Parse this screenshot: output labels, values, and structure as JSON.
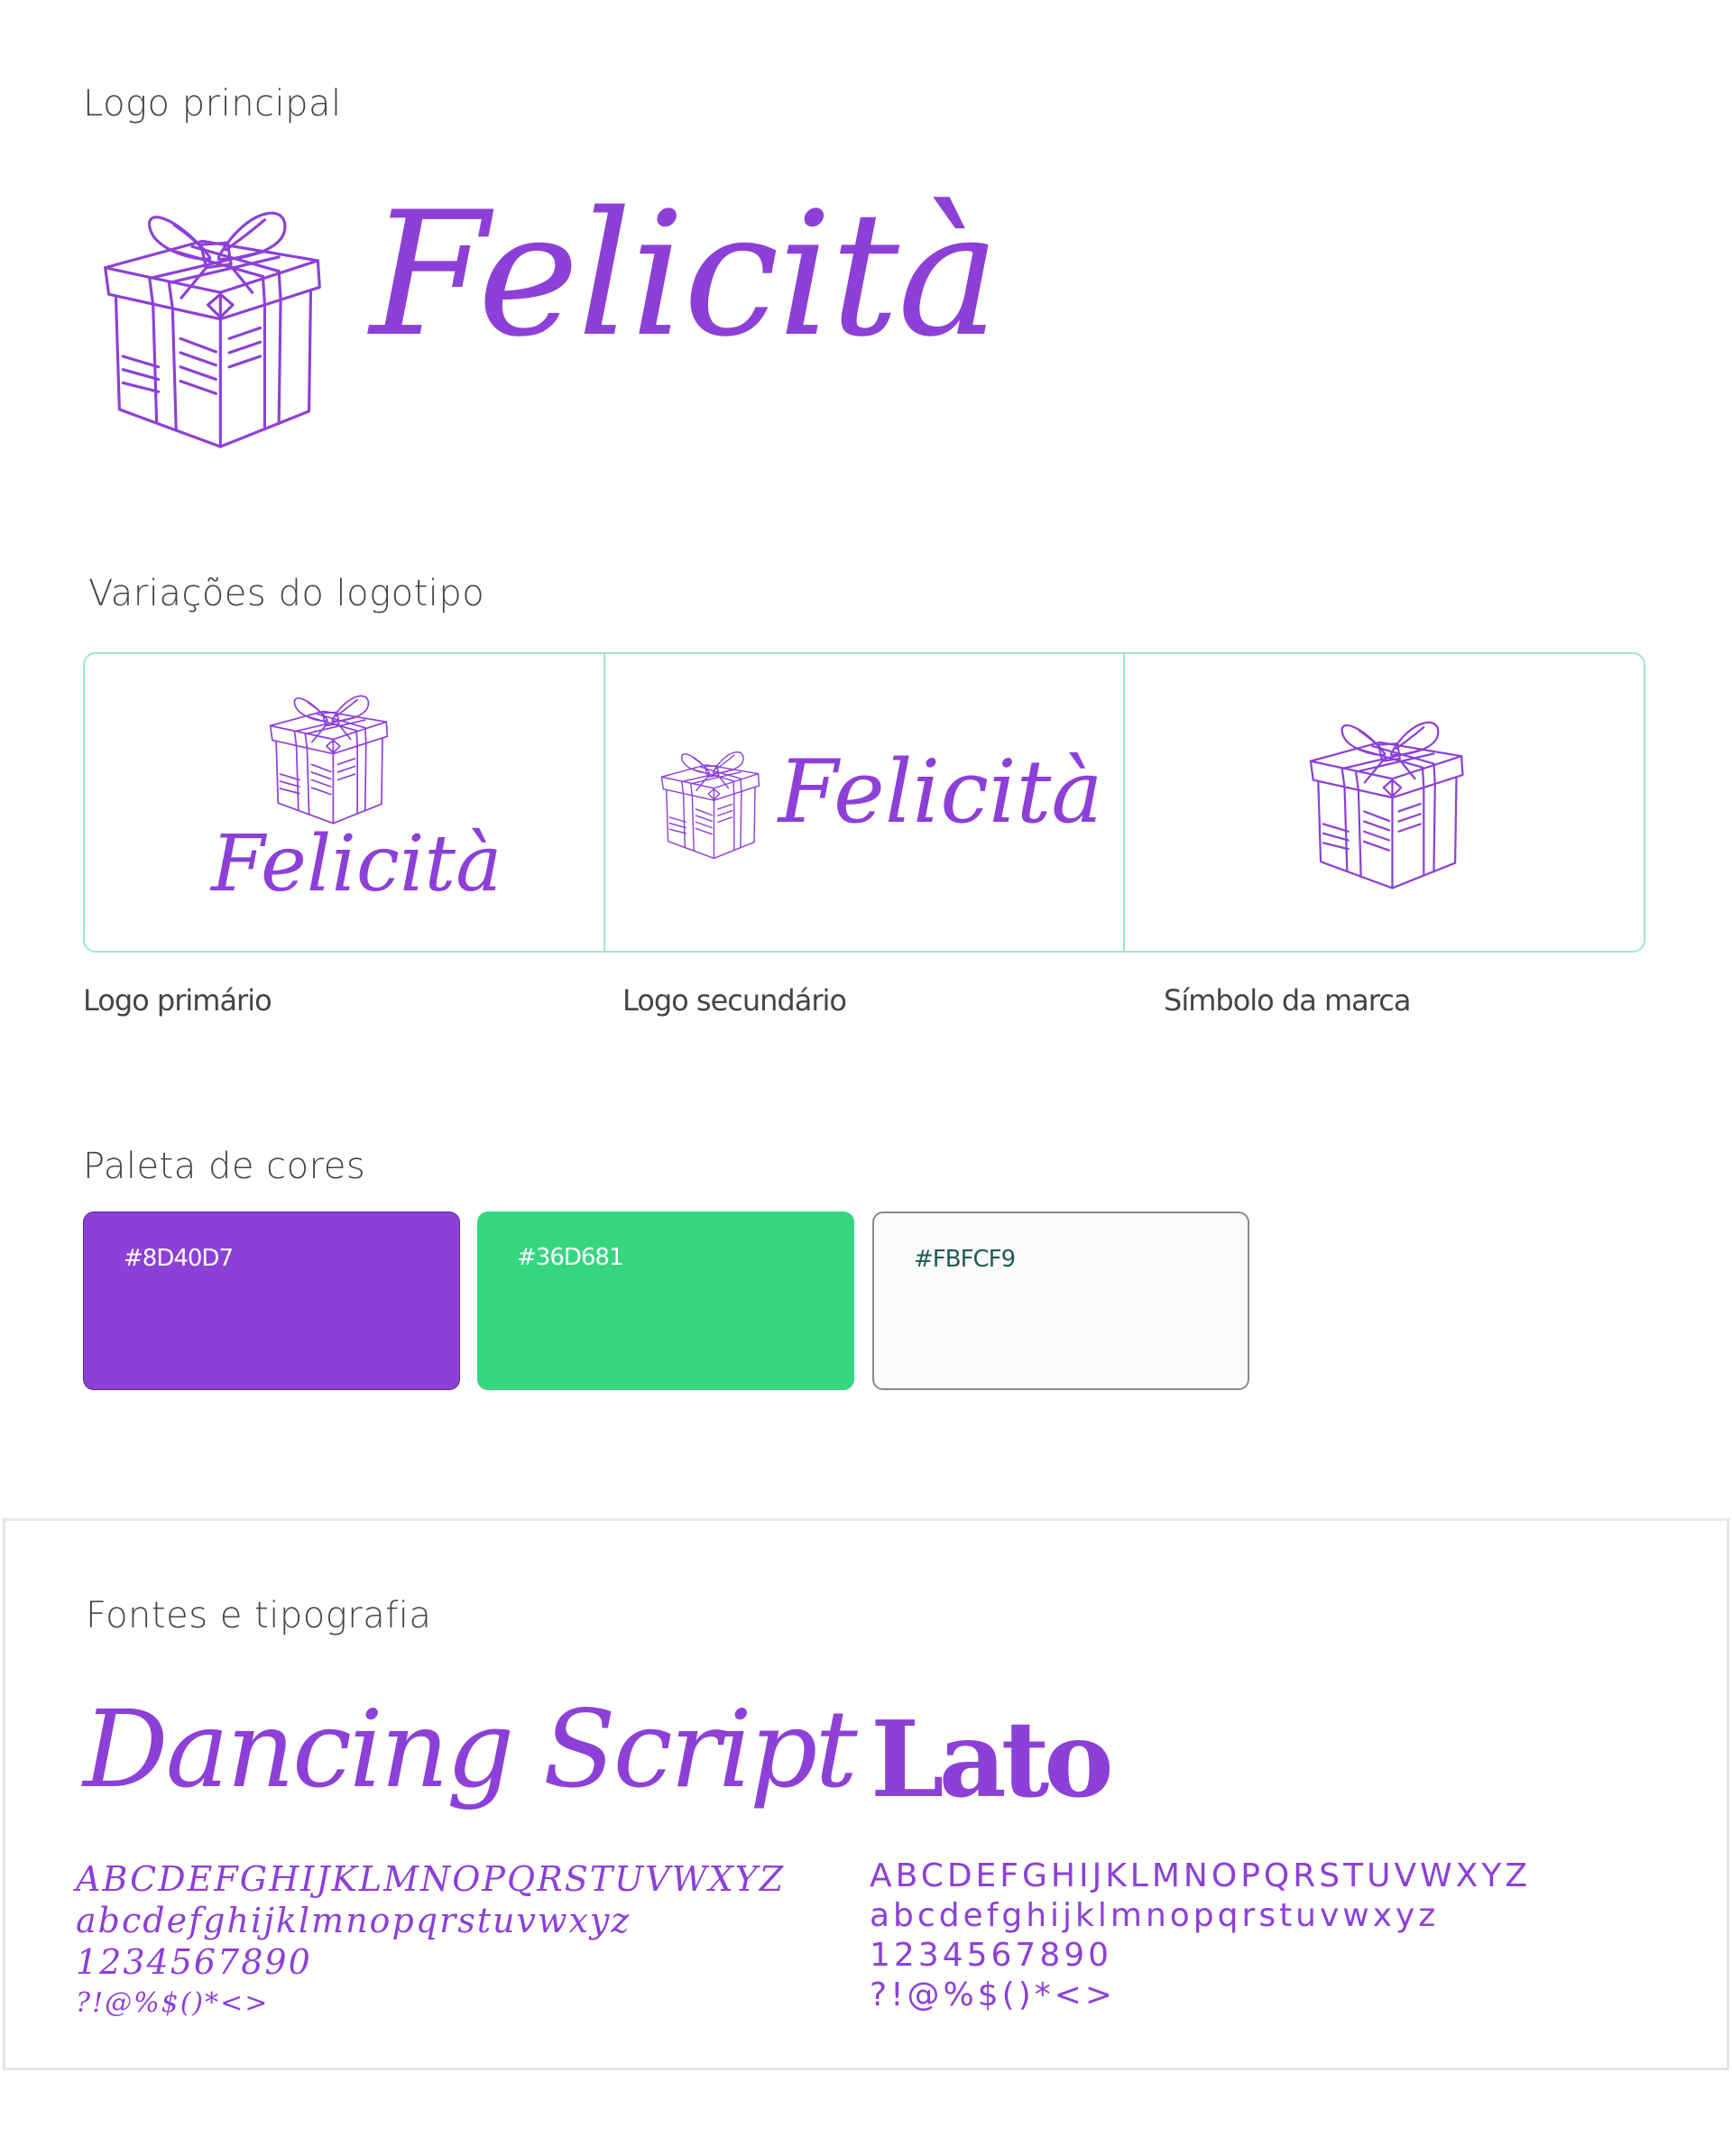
{
  "brand": {
    "name": "Felicità"
  },
  "colors": {
    "primary": "#8D40D7",
    "secondary": "#36D681",
    "neutral": "#FBFCF9",
    "border_accent": "#9fe9c6"
  },
  "main_logo": {
    "title": "Logo principal",
    "wordmark": "Felicità",
    "symbol_icon": "gift-box-icon"
  },
  "variations": {
    "title": "Variações do logotipo",
    "items": [
      {
        "caption": "Logo primário",
        "wordmark": "Felicità",
        "layout": "stacked"
      },
      {
        "caption": "Logo secundário",
        "wordmark": "Felicità",
        "layout": "horizontal"
      },
      {
        "caption": "Símbolo da marca",
        "layout": "symbol-only"
      }
    ]
  },
  "palette": {
    "title": "Paleta de cores",
    "swatches": [
      {
        "hex": "#8D40D7",
        "label": "#8D40D7",
        "text_color": "#ffffff"
      },
      {
        "hex": "#36D681",
        "label": "#36D681",
        "text_color": "#ffffff"
      },
      {
        "hex": "#FBFCF9",
        "label": "#FBFCF9",
        "text_color": "#1f5a5a"
      }
    ]
  },
  "typography": {
    "title": "Fontes e tipografia",
    "fonts": [
      {
        "name": "Dancing Script",
        "uppercase": "ABCDEFGHIJKLMNOPQRSTUVWXYZ",
        "lowercase": "abcdefghijklmnopqrstuvwxyz 1234567890",
        "symbols": "?!@%$()*<>"
      },
      {
        "name": "Lato",
        "uppercase": "ABCDEFGHIJKLMNOPQRSTUVWXYZ",
        "lowercase": "abcdefghijklmnopqrstuvwxyz 1234567890",
        "symbols": "?!@%$()*<>"
      }
    ]
  }
}
